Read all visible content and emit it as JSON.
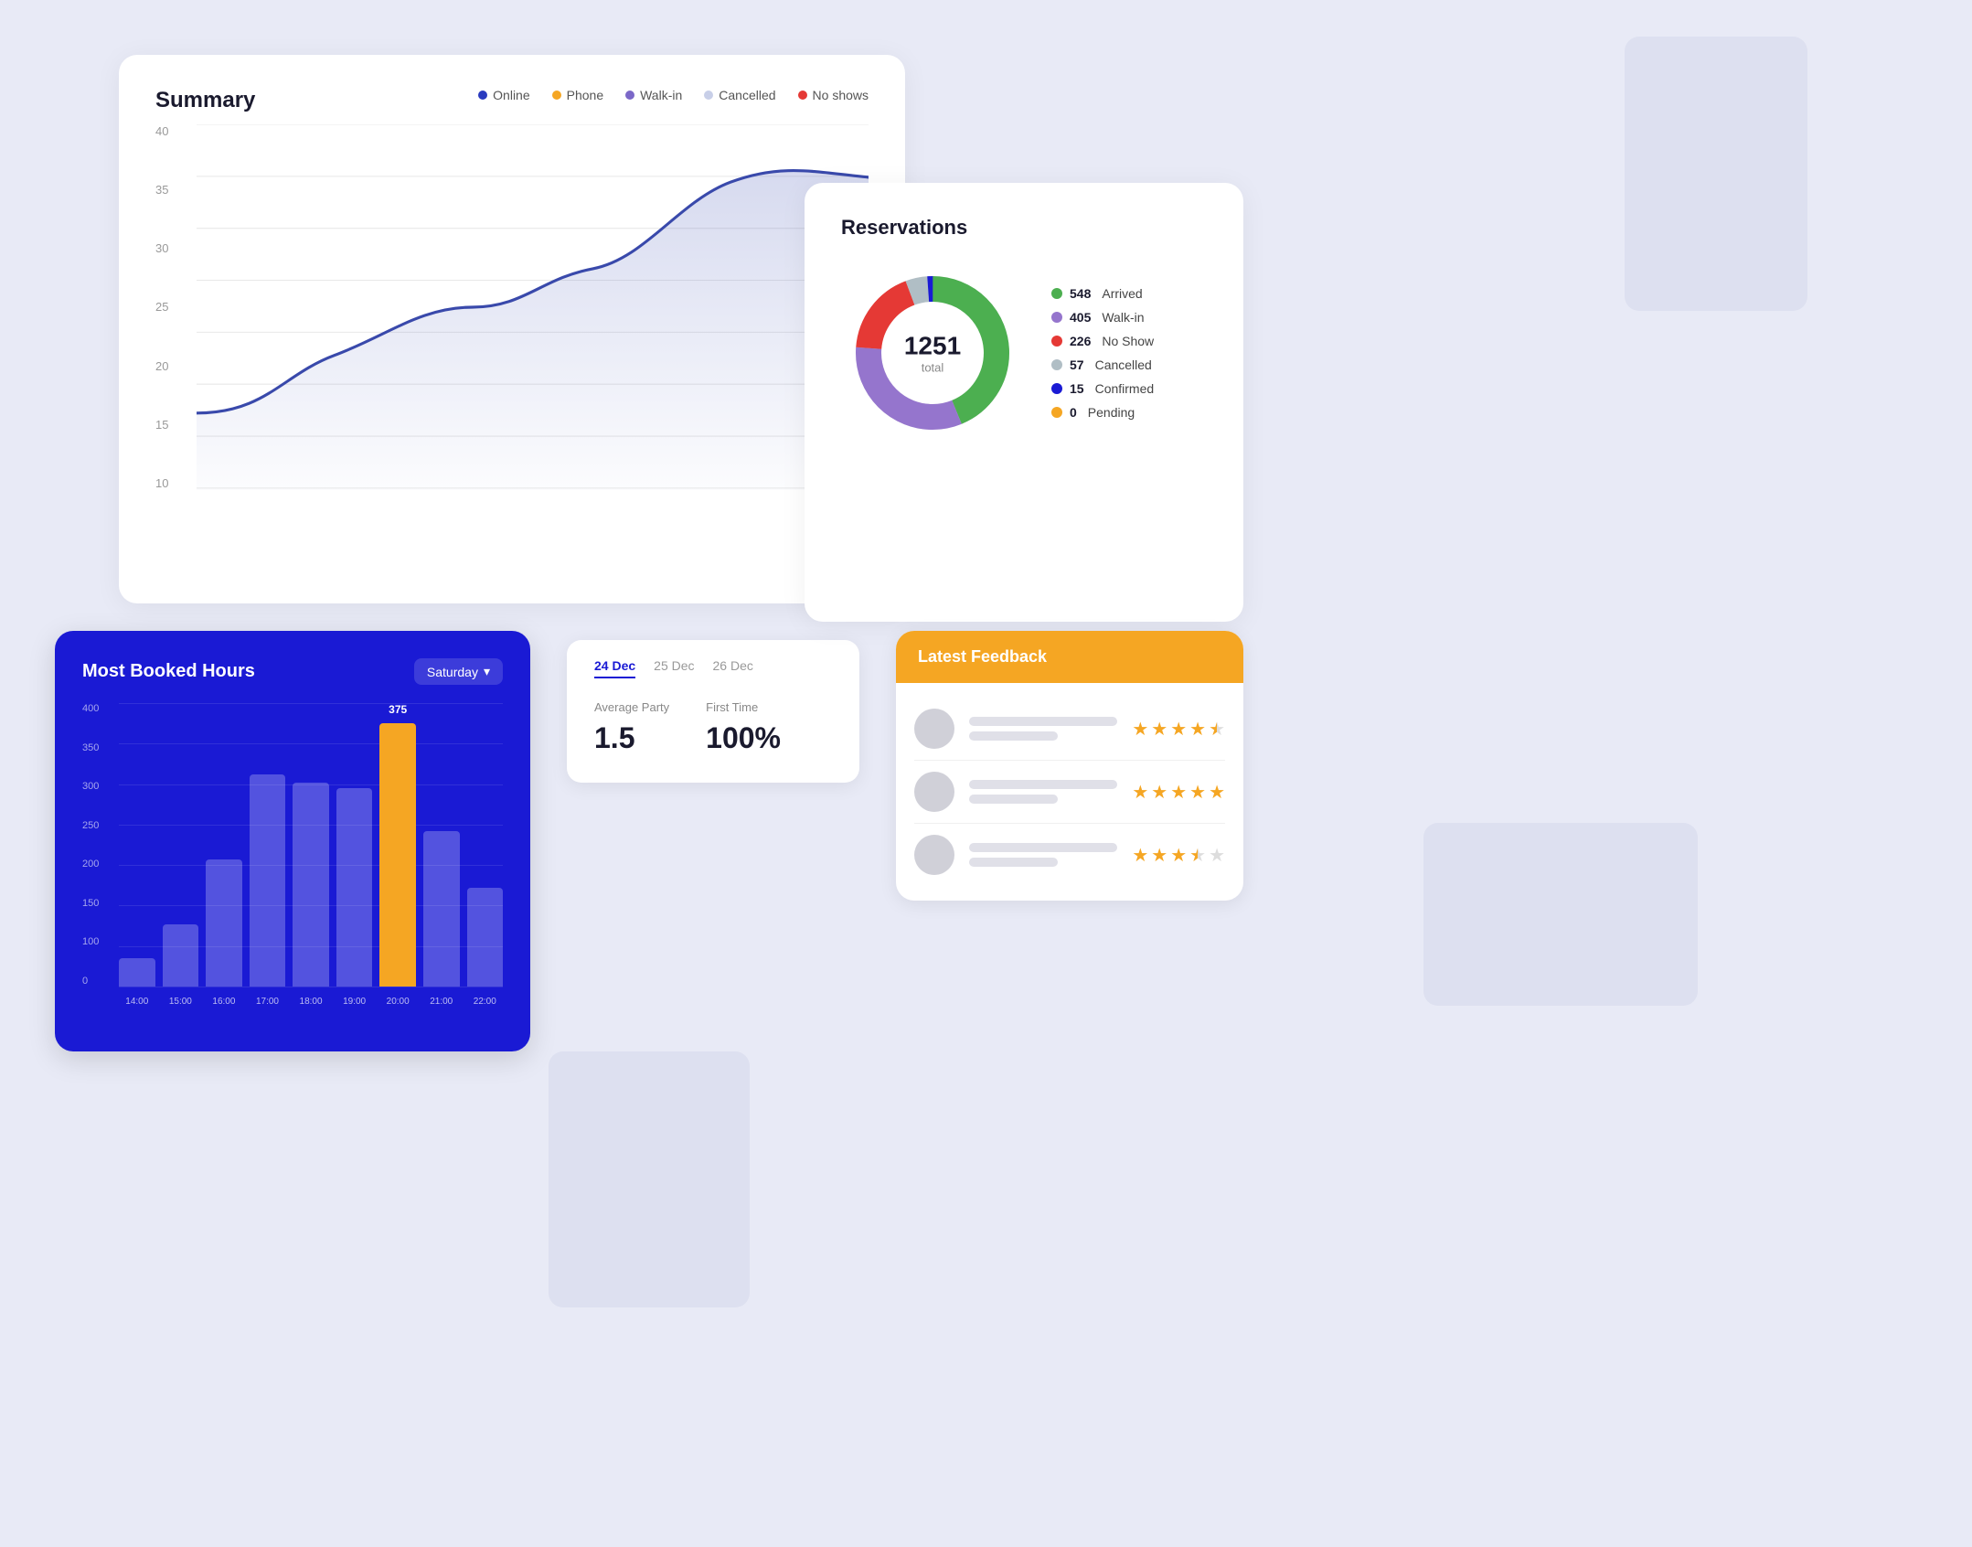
{
  "summary": {
    "title": "Summary",
    "legend": [
      {
        "label": "Online",
        "color": "#2a3bbf"
      },
      {
        "label": "Phone",
        "color": "#f5a623"
      },
      {
        "label": "Walk-in",
        "color": "#7b68c8"
      },
      {
        "label": "Cancelled",
        "color": "#c8cfe8"
      },
      {
        "label": "No shows",
        "color": "#e53935"
      }
    ],
    "yAxis": [
      "40",
      "35",
      "30",
      "25",
      "20",
      "15",
      "10"
    ]
  },
  "reservations": {
    "title": "Reservations",
    "total": "1251",
    "total_label": "total",
    "legend": [
      {
        "label": "Arrived",
        "count": "548",
        "color": "#4caf50"
      },
      {
        "label": "Walk-in",
        "count": "405",
        "color": "#9575cd"
      },
      {
        "label": "No Show",
        "count": "226",
        "color": "#e53935"
      },
      {
        "label": "Cancelled",
        "count": "57",
        "color": "#b0bec5"
      },
      {
        "label": "Confirmed",
        "count": "15",
        "color": "#1a1ad4"
      },
      {
        "label": "Pending",
        "count": "0",
        "color": "#f5a623"
      }
    ]
  },
  "booked_hours": {
    "title": "Most Booked Hours",
    "day_selector": "Saturday",
    "yAxis": [
      "400",
      "350",
      "300",
      "250",
      "200",
      "150",
      "100",
      "0"
    ],
    "bars": [
      {
        "label": "14:00",
        "value": 40,
        "percent": 10,
        "highlight": false
      },
      {
        "label": "15:00",
        "value": 90,
        "percent": 22,
        "highlight": false
      },
      {
        "label": "16:00",
        "value": 180,
        "percent": 45,
        "highlight": false
      },
      {
        "label": "17:00",
        "value": 300,
        "percent": 75,
        "highlight": false
      },
      {
        "label": "18:00",
        "value": 290,
        "percent": 72,
        "highlight": false
      },
      {
        "label": "19:00",
        "value": 280,
        "percent": 70,
        "highlight": false
      },
      {
        "label": "20:00",
        "value": 375,
        "percent": 93,
        "highlight": true
      },
      {
        "label": "21:00",
        "value": 220,
        "percent": 55,
        "highlight": false
      },
      {
        "label": "22:00",
        "value": 140,
        "percent": 35,
        "highlight": false
      }
    ],
    "highlighted_value": "375"
  },
  "date_tabs": {
    "tabs": [
      {
        "label": "24 Dec",
        "active": true
      },
      {
        "label": "25 Dec",
        "active": false
      },
      {
        "label": "26 Dec",
        "active": false
      }
    ],
    "stats": [
      {
        "label": "Average Party",
        "value": "1.5"
      },
      {
        "label": "First Time",
        "value": "100%"
      }
    ]
  },
  "feedback": {
    "title": "Latest Feedback",
    "items": [
      {
        "stars": 4.5,
        "lines": [
          80,
          60
        ]
      },
      {
        "stars": 5,
        "lines": [
          90,
          70
        ]
      },
      {
        "stars": 3.5,
        "lines": [
          75,
          55
        ]
      }
    ]
  }
}
